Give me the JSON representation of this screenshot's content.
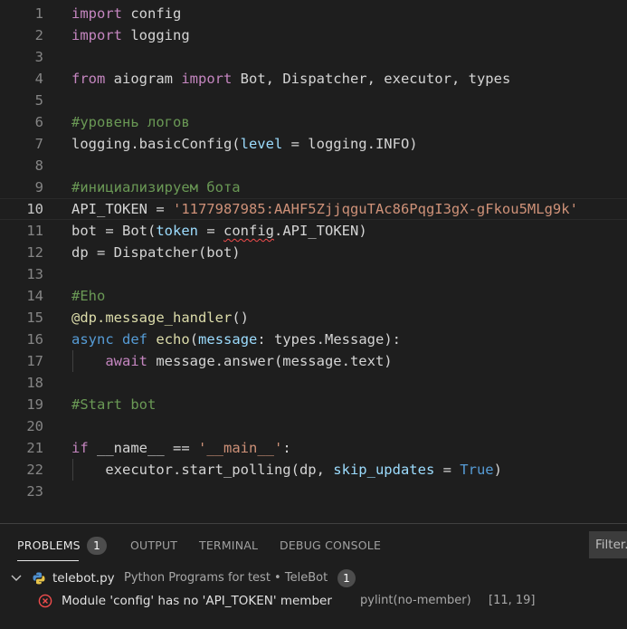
{
  "editor": {
    "lines": [
      {
        "n": "1",
        "tokens": [
          {
            "t": "import",
            "c": "kw"
          },
          {
            "t": " config",
            "c": "df"
          }
        ]
      },
      {
        "n": "2",
        "tokens": [
          {
            "t": "import",
            "c": "kw"
          },
          {
            "t": " logging",
            "c": "df"
          }
        ]
      },
      {
        "n": "3",
        "tokens": []
      },
      {
        "n": "4",
        "tokens": [
          {
            "t": "from",
            "c": "kw"
          },
          {
            "t": " aiogram ",
            "c": "df"
          },
          {
            "t": "import",
            "c": "kw"
          },
          {
            "t": " Bot, Dispatcher, executor, types",
            "c": "df"
          }
        ]
      },
      {
        "n": "5",
        "tokens": []
      },
      {
        "n": "6",
        "tokens": [
          {
            "t": "#уровень логов",
            "c": "cm"
          }
        ]
      },
      {
        "n": "7",
        "tokens": [
          {
            "t": "logging.basicConfig(",
            "c": "df"
          },
          {
            "t": "level",
            "c": "pr"
          },
          {
            "t": " = logging.INFO)",
            "c": "df"
          }
        ]
      },
      {
        "n": "8",
        "tokens": []
      },
      {
        "n": "9",
        "tokens": [
          {
            "t": "#инициализируем бота",
            "c": "cm"
          }
        ]
      },
      {
        "n": "10",
        "current": true,
        "tokens": [
          {
            "t": "API_TOKEN = ",
            "c": "df"
          },
          {
            "t": "'1177987985:AAHF5ZjjqguTAc86PqgI3gX-gFkou5MLg9k'",
            "c": "st"
          }
        ]
      },
      {
        "n": "11",
        "tokens": [
          {
            "t": "bot = Bot(",
            "c": "df"
          },
          {
            "t": "token",
            "c": "pr"
          },
          {
            "t": " = ",
            "c": "df"
          },
          {
            "t": "config",
            "c": "df",
            "squig": true
          },
          {
            "t": ".API_TOKEN)",
            "c": "df"
          }
        ]
      },
      {
        "n": "12",
        "tokens": [
          {
            "t": "dp = Dispatcher(bot)",
            "c": "df"
          }
        ]
      },
      {
        "n": "13",
        "tokens": []
      },
      {
        "n": "14",
        "tokens": [
          {
            "t": "#Eho",
            "c": "cm"
          }
        ]
      },
      {
        "n": "15",
        "tokens": [
          {
            "t": "@dp.message_handler",
            "c": "fn"
          },
          {
            "t": "()",
            "c": "df"
          }
        ]
      },
      {
        "n": "16",
        "tokens": [
          {
            "t": "async",
            "c": "kb"
          },
          {
            "t": " ",
            "c": "df"
          },
          {
            "t": "def",
            "c": "kb"
          },
          {
            "t": " ",
            "c": "df"
          },
          {
            "t": "echo",
            "c": "fn"
          },
          {
            "t": "(",
            "c": "df"
          },
          {
            "t": "message",
            "c": "pr"
          },
          {
            "t": ": types.Message):",
            "c": "df"
          }
        ]
      },
      {
        "n": "17",
        "guide": true,
        "tokens": [
          {
            "t": "    ",
            "c": "df"
          },
          {
            "t": "await",
            "c": "kw"
          },
          {
            "t": " message.answer(message.text)",
            "c": "df"
          }
        ]
      },
      {
        "n": "18",
        "tokens": []
      },
      {
        "n": "19",
        "tokens": [
          {
            "t": "#Start bot",
            "c": "cm"
          }
        ]
      },
      {
        "n": "20",
        "tokens": []
      },
      {
        "n": "21",
        "tokens": [
          {
            "t": "if",
            "c": "kw"
          },
          {
            "t": " __name__ == ",
            "c": "df"
          },
          {
            "t": "'__main__'",
            "c": "st"
          },
          {
            "t": ":",
            "c": "df"
          }
        ]
      },
      {
        "n": "22",
        "guide": true,
        "tokens": [
          {
            "t": "    executor.start_polling(dp, ",
            "c": "df"
          },
          {
            "t": "skip_updates",
            "c": "pr"
          },
          {
            "t": " = ",
            "c": "df"
          },
          {
            "t": "True",
            "c": "kb"
          },
          {
            "t": ")",
            "c": "df"
          }
        ]
      },
      {
        "n": "23",
        "tokens": []
      }
    ]
  },
  "panel": {
    "tabs": {
      "problems": "PROBLEMS",
      "problems_count": "1",
      "output": "OUTPUT",
      "terminal": "TERMINAL",
      "debug_console": "DEBUG CONSOLE"
    },
    "filter_placeholder": "Filter.",
    "file": {
      "name": "telebot.py",
      "description": "Python Programs for test • TeleBot",
      "count": "1"
    },
    "problem": {
      "message": "Module 'config' has no 'API_TOKEN' member",
      "source": "pylint(no-member)",
      "location": "[11, 19]"
    }
  },
  "colors": {
    "background": "#1e1e1e",
    "keyword": "#c586c0",
    "storage": "#569cd6",
    "comment": "#6a9955",
    "string": "#ce9178",
    "function": "#dcdcaa",
    "parameter": "#9cdcfe",
    "error": "#f14c4c"
  },
  "icons": [
    "chevron-down-icon",
    "python-file-icon",
    "error-circle-icon"
  ]
}
